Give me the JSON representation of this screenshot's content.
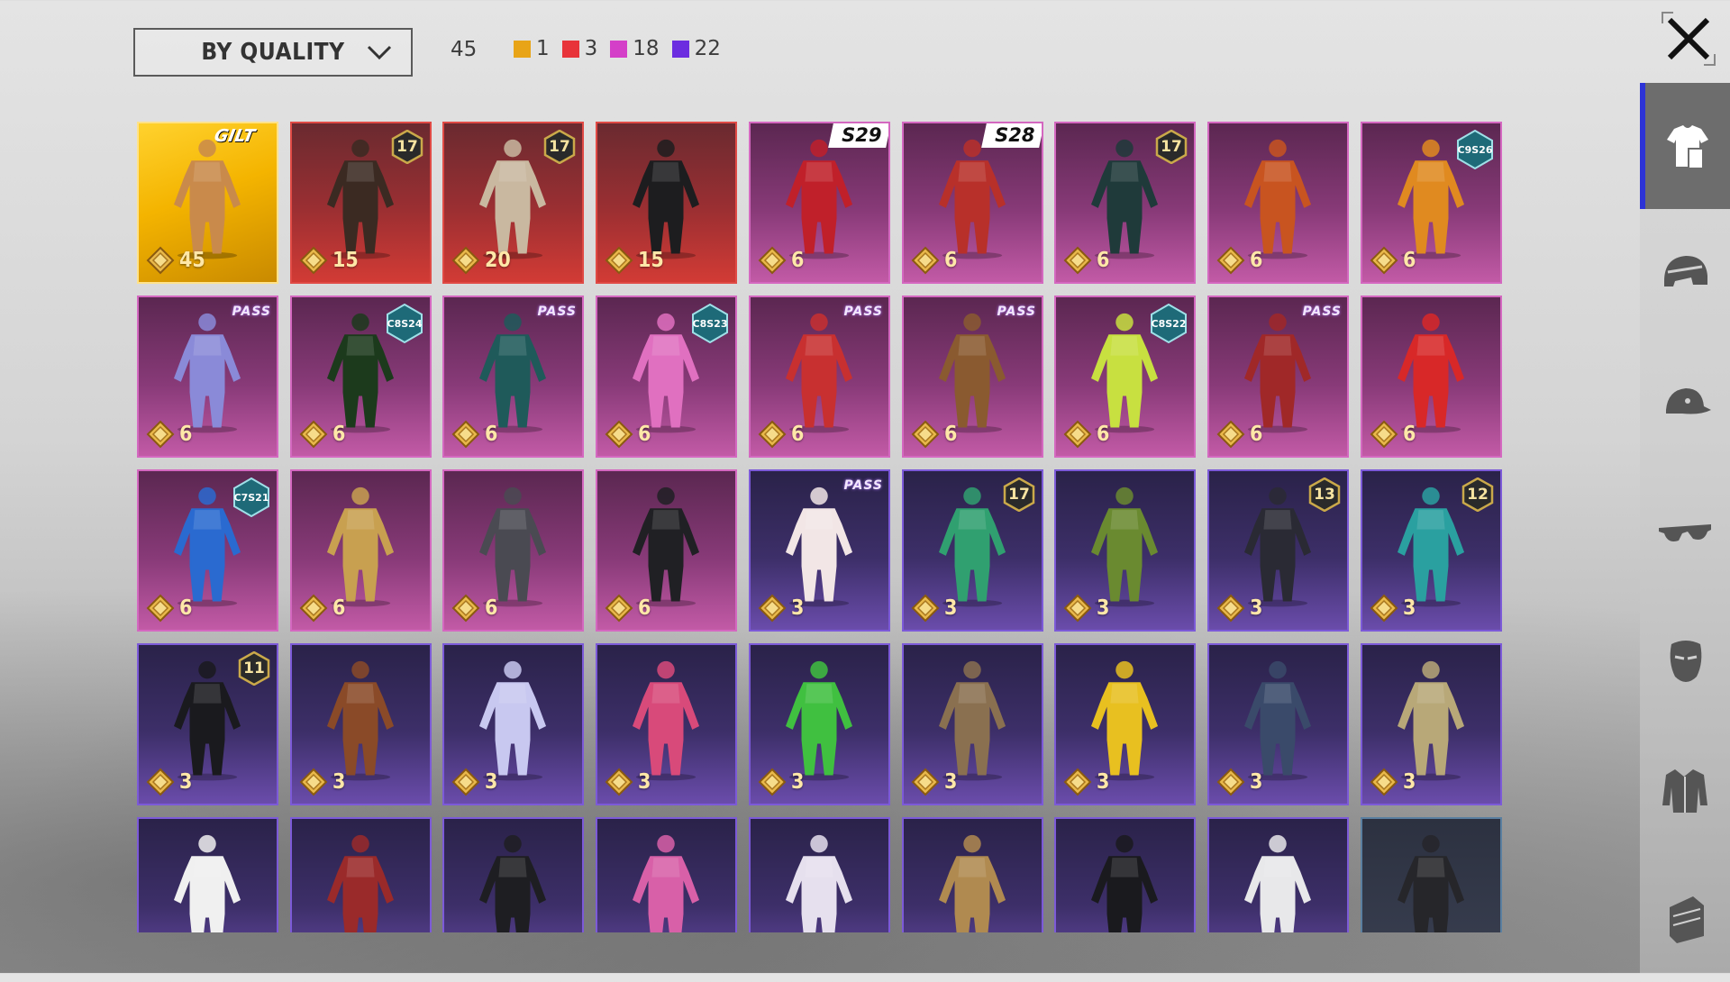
{
  "header": {
    "sort_label": "BY QUALITY",
    "total": "45",
    "quality_counts": [
      {
        "color": "#e8a417",
        "count": "1"
      },
      {
        "color": "#e8343a",
        "count": "3"
      },
      {
        "color": "#d43fc8",
        "count": "18"
      },
      {
        "color": "#6c2de0",
        "count": "22"
      }
    ]
  },
  "sidebar": {
    "tabs": [
      {
        "name": "outfit-tab",
        "icon": "outfit-icon",
        "active": true
      },
      {
        "name": "helmet-tab",
        "icon": "helmet-icon",
        "active": false
      },
      {
        "name": "hat-tab",
        "icon": "cap-icon",
        "active": false
      },
      {
        "name": "glasses-tab",
        "icon": "glasses-icon",
        "active": false
      },
      {
        "name": "mask-tab",
        "icon": "mask-icon",
        "active": false
      },
      {
        "name": "jacket-tab",
        "icon": "jacket-icon",
        "active": false
      },
      {
        "name": "backpack-tab",
        "icon": "backpack-icon",
        "active": false
      }
    ]
  },
  "items": [
    {
      "tier": "gold",
      "price": "45",
      "badge": "brand",
      "badge_text": "GILT",
      "figure": "#c98a4b"
    },
    {
      "tier": "red",
      "price": "15",
      "badge": "level",
      "badge_text": "17",
      "figure": "#3b2a22"
    },
    {
      "tier": "red",
      "price": "20",
      "badge": "level",
      "badge_text": "17",
      "figure": "#c9b8a0"
    },
    {
      "tier": "red",
      "price": "15",
      "badge": "",
      "badge_text": "",
      "figure": "#1d1d1f"
    },
    {
      "tier": "pink",
      "price": "6",
      "badge": "season",
      "badge_text": "S29",
      "figure": "#c0202a"
    },
    {
      "tier": "pink",
      "price": "6",
      "badge": "season",
      "badge_text": "S28",
      "figure": "#b8302a"
    },
    {
      "tier": "pink",
      "price": "6",
      "badge": "level",
      "badge_text": "17",
      "figure": "#1f3a3a"
    },
    {
      "tier": "pink",
      "price": "6",
      "badge": "",
      "badge_text": "",
      "figure": "#c85420"
    },
    {
      "tier": "pink",
      "price": "6",
      "badge": "cs",
      "badge_text": "C9S26",
      "figure": "#e08a20"
    },
    {
      "tier": "pink",
      "price": "6",
      "badge": "pass",
      "badge_text": "PASS",
      "figure": "#8a8ad8"
    },
    {
      "tier": "pink",
      "price": "6",
      "badge": "cs",
      "badge_text": "C8S24",
      "figure": "#1c3a1c"
    },
    {
      "tier": "pink",
      "price": "6",
      "badge": "pass",
      "badge_text": "PASS",
      "figure": "#1f5a5a"
    },
    {
      "tier": "pink",
      "price": "6",
      "badge": "cs",
      "badge_text": "C8S23",
      "figure": "#e070c0"
    },
    {
      "tier": "pink",
      "price": "6",
      "badge": "pass",
      "badge_text": "PASS",
      "figure": "#c83030"
    },
    {
      "tier": "pink",
      "price": "6",
      "badge": "pass",
      "badge_text": "PASS",
      "figure": "#8a5a30"
    },
    {
      "tier": "pink",
      "price": "6",
      "badge": "cs",
      "badge_text": "C8S22",
      "figure": "#c8e040"
    },
    {
      "tier": "pink",
      "price": "6",
      "badge": "pass",
      "badge_text": "PASS",
      "figure": "#a02828"
    },
    {
      "tier": "pink",
      "price": "6",
      "badge": "",
      "badge_text": "",
      "figure": "#d82828"
    },
    {
      "tier": "pink",
      "price": "6",
      "badge": "cs",
      "badge_text": "C7S21",
      "figure": "#2a6ad0"
    },
    {
      "tier": "pink",
      "price": "6",
      "badge": "",
      "badge_text": "",
      "figure": "#c8a050"
    },
    {
      "tier": "pink",
      "price": "6",
      "badge": "",
      "badge_text": "",
      "figure": "#4a4a52"
    },
    {
      "tier": "pink",
      "price": "6",
      "badge": "",
      "badge_text": "",
      "figure": "#202024"
    },
    {
      "tier": "purple",
      "price": "3",
      "badge": "pass",
      "badge_text": "PASS",
      "figure": "#f2e6e6"
    },
    {
      "tier": "purple",
      "price": "3",
      "badge": "level",
      "badge_text": "17",
      "figure": "#30a070"
    },
    {
      "tier": "purple",
      "price": "3",
      "badge": "",
      "badge_text": "",
      "figure": "#6a8a30"
    },
    {
      "tier": "purple",
      "price": "3",
      "badge": "level",
      "badge_text": "13",
      "figure": "#2a2a34"
    },
    {
      "tier": "purple",
      "price": "3",
      "badge": "level",
      "badge_text": "12",
      "figure": "#2aa0a0"
    },
    {
      "tier": "purple",
      "price": "3",
      "badge": "level",
      "badge_text": "11",
      "figure": "#1a1a1e"
    },
    {
      "tier": "purple",
      "price": "3",
      "badge": "",
      "badge_text": "",
      "figure": "#8a4a28"
    },
    {
      "tier": "purple",
      "price": "3",
      "badge": "",
      "badge_text": "",
      "figure": "#c8c8f0"
    },
    {
      "tier": "purple",
      "price": "3",
      "badge": "",
      "badge_text": "",
      "figure": "#d84a7a"
    },
    {
      "tier": "purple",
      "price": "3",
      "badge": "",
      "badge_text": "",
      "figure": "#40c040"
    },
    {
      "tier": "purple",
      "price": "3",
      "badge": "",
      "badge_text": "",
      "figure": "#8a7050"
    },
    {
      "tier": "purple",
      "price": "3",
      "badge": "",
      "badge_text": "",
      "figure": "#e8c020"
    },
    {
      "tier": "purple",
      "price": "3",
      "badge": "",
      "badge_text": "",
      "figure": "#3a4a6a"
    },
    {
      "tier": "purple",
      "price": "3",
      "badge": "",
      "badge_text": "",
      "figure": "#b8a878"
    },
    {
      "tier": "purple",
      "price": "",
      "badge": "",
      "badge_text": "",
      "figure": "#f0f0f0"
    },
    {
      "tier": "purple",
      "price": "",
      "badge": "",
      "badge_text": "",
      "figure": "#9a2a2a"
    },
    {
      "tier": "purple",
      "price": "",
      "badge": "",
      "badge_text": "",
      "figure": "#1e1e22"
    },
    {
      "tier": "purple",
      "price": "",
      "badge": "",
      "badge_text": "",
      "figure": "#d860a8"
    },
    {
      "tier": "purple",
      "price": "",
      "badge": "",
      "badge_text": "",
      "figure": "#e6e0ee"
    },
    {
      "tier": "purple",
      "price": "",
      "badge": "",
      "badge_text": "",
      "figure": "#b08a50"
    },
    {
      "tier": "purple",
      "price": "",
      "badge": "",
      "badge_text": "",
      "figure": "#1a1a1e"
    },
    {
      "tier": "purple",
      "price": "",
      "badge": "",
      "badge_text": "",
      "figure": "#e8e8ea"
    },
    {
      "tier": "dark",
      "price": "",
      "badge": "",
      "badge_text": "",
      "figure": "#26262a"
    }
  ]
}
